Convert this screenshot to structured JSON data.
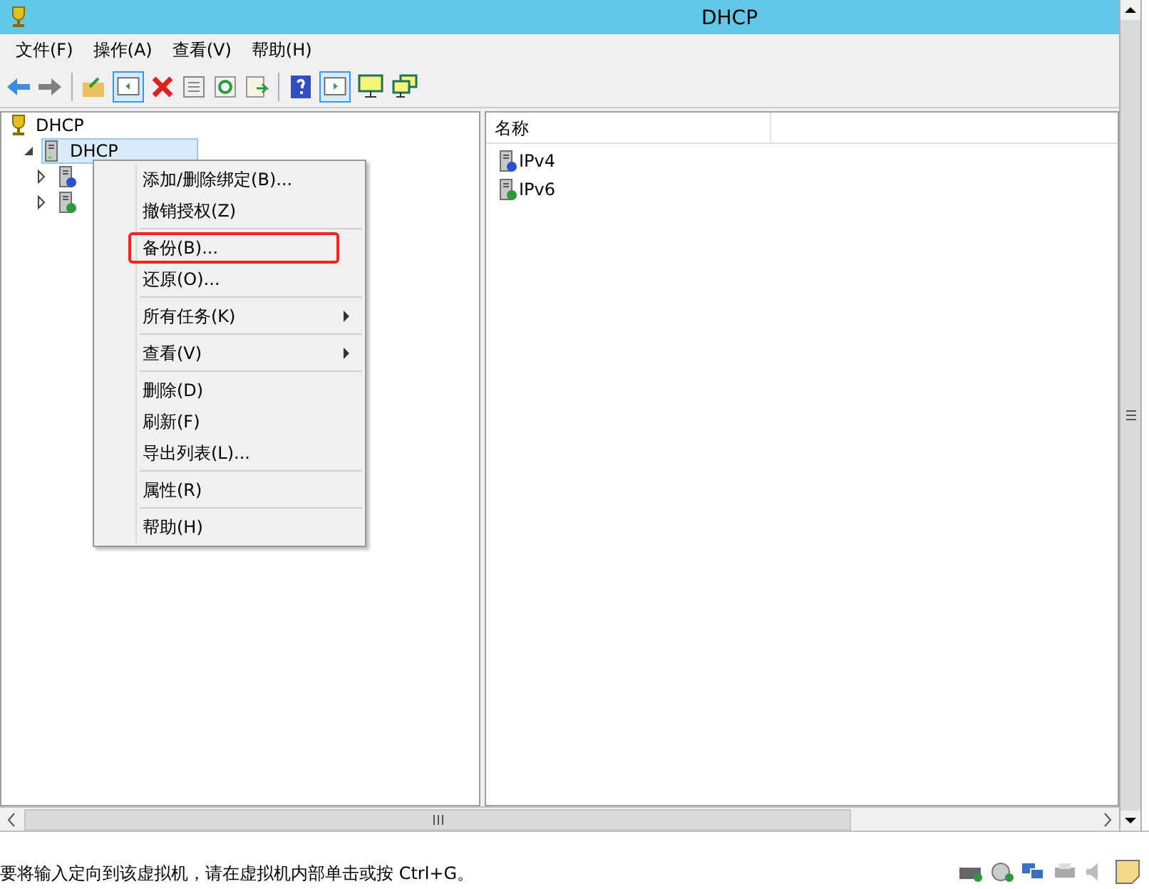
{
  "window": {
    "title": "DHCP"
  },
  "menu_bar": [
    {
      "label": "文件(F)"
    },
    {
      "label": "操作(A)"
    },
    {
      "label": "查看(V)"
    },
    {
      "label": "帮助(H)"
    }
  ],
  "tree": [
    {
      "label": "DHCP",
      "kind": "root",
      "selected": false,
      "children": [
        {
          "label": "DHCP",
          "kind": "server",
          "expanded": true,
          "selected": true,
          "children": [
            {
              "kind": "info",
              "expanded": false,
              "selected": false
            },
            {
              "kind": "ok",
              "expanded": false,
              "selected": false
            }
          ]
        }
      ]
    }
  ],
  "context_menu": [
    {
      "kind": "item",
      "label": "添加/删除绑定(B)...",
      "boxed": false
    },
    {
      "kind": "item",
      "label": "撤销授权(Z)",
      "boxed": false
    },
    {
      "kind": "separator"
    },
    {
      "kind": "item",
      "label": "备份(B)...",
      "boxed": true
    },
    {
      "kind": "item",
      "label": "还原(O)...",
      "boxed": false
    },
    {
      "kind": "separator"
    },
    {
      "kind": "submenu",
      "label": "所有任务(K)",
      "boxed": false
    },
    {
      "kind": "separator"
    },
    {
      "kind": "submenu",
      "label": "查看(V)",
      "boxed": false
    },
    {
      "kind": "separator"
    },
    {
      "kind": "item",
      "label": "删除(D)",
      "boxed": false
    },
    {
      "kind": "item",
      "label": "刷新(F)",
      "boxed": false
    },
    {
      "kind": "item",
      "label": "导出列表(L)...",
      "boxed": false
    },
    {
      "kind": "separator"
    },
    {
      "kind": "item",
      "label": "属性(R)",
      "boxed": false
    },
    {
      "kind": "separator"
    },
    {
      "kind": "item",
      "label": "帮助(H)",
      "boxed": false
    }
  ],
  "list": {
    "columns": [
      "名称"
    ],
    "rows": [
      {
        "name": "IPv4",
        "kind": "info"
      },
      {
        "name": "IPv6",
        "kind": "ok"
      }
    ]
  },
  "status_bar": {
    "text": "要将输入定向到该虚拟机，请在虚拟机内部单击或按 Ctrl+G。"
  }
}
